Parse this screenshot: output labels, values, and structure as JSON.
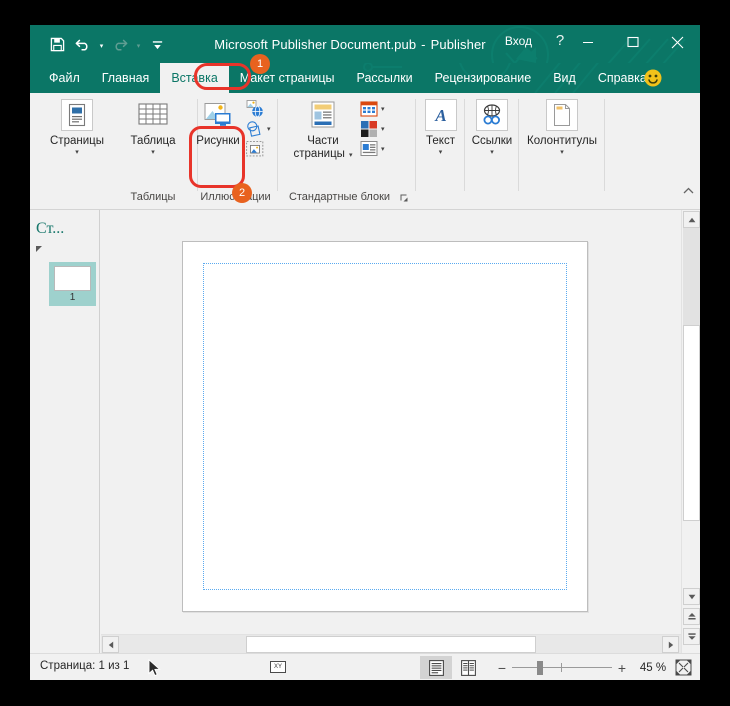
{
  "window": {
    "title_document": "Microsoft Publisher Document.pub",
    "title_separator": "-",
    "title_app": "Publisher",
    "signin_label": "Вход",
    "help_label": "?",
    "minimize_label": "minimize-icon",
    "maximize_label": "maximize-icon",
    "close_label": "close-icon"
  },
  "quick_access": {
    "save": "save-icon",
    "undo": "undo-icon",
    "redo": "redo-icon",
    "customize": "customize-quick-access-icon",
    "caret": "▾"
  },
  "tabs": [
    {
      "label": "Файл",
      "active": false
    },
    {
      "label": "Главная",
      "active": false
    },
    {
      "label": "Вставка",
      "active": true
    },
    {
      "label": "Макет страницы",
      "active": false
    },
    {
      "label": "Рассылки",
      "active": false
    },
    {
      "label": "Рецензирование",
      "active": false
    },
    {
      "label": "Вид",
      "active": false
    },
    {
      "label": "Справка",
      "active": false
    }
  ],
  "ribbon": {
    "groups": [
      {
        "name": "Таблицы",
        "label": "Таблицы",
        "buttons": [
          {
            "label": "Страницы",
            "icon": "pages-icon",
            "caret": "▾"
          },
          {
            "label": "Таблица",
            "icon": "table-icon",
            "caret": "▾"
          }
        ]
      },
      {
        "name": "Иллюстрации",
        "label": "Иллюстрации",
        "buttons": [
          {
            "label": "Рисунки",
            "icon": "pictures-icon"
          }
        ],
        "small_buttons": [
          {
            "label": "online-pictures-icon"
          },
          {
            "label": "shapes-icon",
            "caret": "▾"
          },
          {
            "label": "picture-placeholder-icon"
          }
        ]
      },
      {
        "name": "Стандартные блоки",
        "label": "Стандартные блоки",
        "buttons": [
          {
            "label": "Части\nстраницы",
            "label_line1": "Части",
            "label_line2": "страницы",
            "icon": "page-parts-icon",
            "caret": "▾"
          }
        ],
        "small_buttons": [
          {
            "label": "calendars-icon",
            "caret": "▾"
          },
          {
            "label": "borders-accents-icon",
            "caret": "▾"
          },
          {
            "label": "advertisements-icon",
            "caret": "▾"
          }
        ],
        "dialog_launcher": "dialog-launcher-icon"
      },
      {
        "name": "Текст",
        "label": "",
        "buttons": [
          {
            "label": "Текст",
            "icon": "text-icon",
            "caret": "▾"
          }
        ]
      },
      {
        "name": "Ссылки",
        "label": "",
        "buttons": [
          {
            "label": "Ссылки",
            "icon": "links-icon",
            "caret": "▾"
          }
        ]
      },
      {
        "name": "Колонтитулы",
        "label": "",
        "buttons": [
          {
            "label": "Колонтитулы",
            "icon": "header-footer-icon",
            "caret": "▾"
          }
        ]
      }
    ],
    "collapse_icon": "collapse-ribbon-icon"
  },
  "thumbnail_pane": {
    "title": "Ст...",
    "collapse_icon": "collapse-pane-icon",
    "pages": [
      {
        "number": "1"
      }
    ]
  },
  "status_bar": {
    "page_indicator": "Страница: 1 из 1",
    "cursor_icon": "mouse-pointer-icon",
    "keyboard_indicator": "XY",
    "view_single": "single-page-view-icon",
    "view_two": "two-page-spread-view-icon",
    "zoom_out": "−",
    "zoom_in": "+",
    "zoom_percent": "45 %",
    "fit_icon": "fit-to-window-icon"
  },
  "scrollbars": {
    "v_up": "▲",
    "v_down": "▼",
    "v_prev_page": "⯅",
    "v_next_page": "⯆",
    "h_left": "◀",
    "h_right": "▶"
  },
  "annotations": [
    {
      "id": "1",
      "target": "Вставка"
    },
    {
      "id": "2",
      "target": "Рисунки"
    }
  ],
  "colors": {
    "brand": "#0b7666",
    "accent_badge": "#e8621f",
    "annotation_ring": "#e8342a",
    "thumb_selected": "#9ed1cd",
    "guide": "#5aaaf0"
  }
}
